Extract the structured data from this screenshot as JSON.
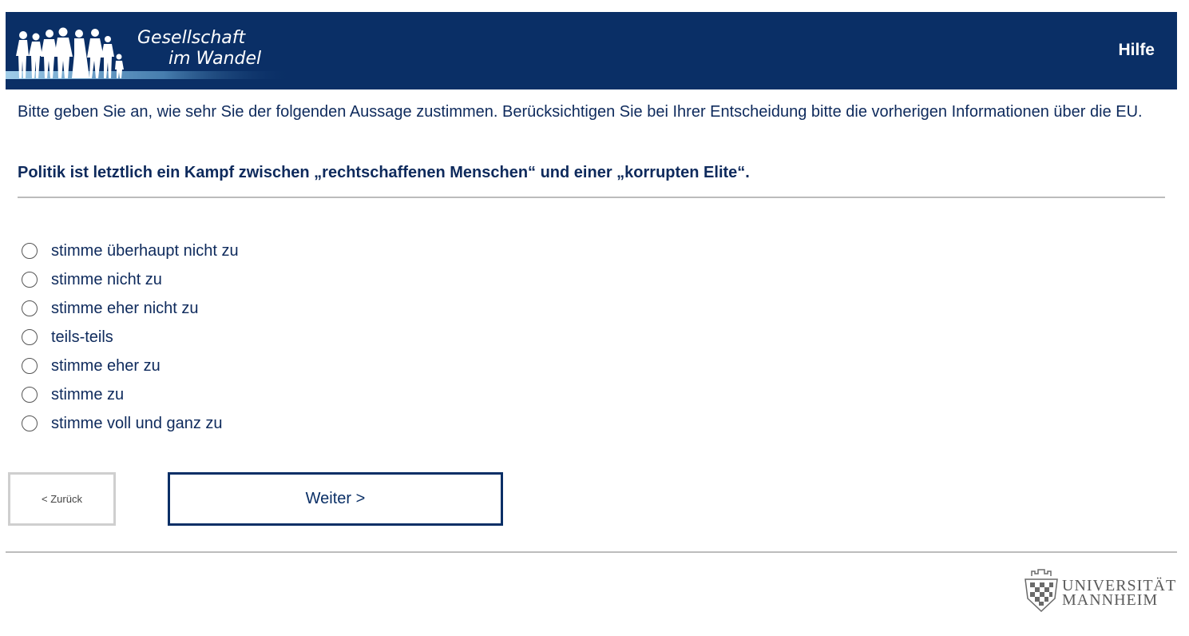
{
  "header": {
    "logo_line1": "Gesellschaft",
    "logo_line2": "im Wandel",
    "help_label": "Hilfe"
  },
  "intro_text": "Bitte geben Sie an, wie sehr Sie der folgenden Aussage zustimmen. Berücksichtigen Sie bei Ihrer Entscheidung bitte die vorherigen Informationen über die EU.",
  "question_text": "Politik ist letztlich ein Kampf zwischen „rechtschaffenen Menschen“ und einer „korrupten Elite“.",
  "options": [
    "stimme überhaupt nicht zu",
    "stimme nicht zu",
    "stimme eher nicht zu",
    "teils-teils",
    "stimme eher zu",
    "stimme zu",
    "stimme voll und ganz zu"
  ],
  "nav": {
    "back_label": "< Zurück",
    "next_label": "Weiter >"
  },
  "footer": {
    "uni_line1": "UNIVERSITÄT",
    "uni_line2": "MANNHEIM"
  },
  "colors": {
    "header_bg": "#0a2f66",
    "text": "#0e2a5c",
    "divider": "#bcbcbc"
  }
}
